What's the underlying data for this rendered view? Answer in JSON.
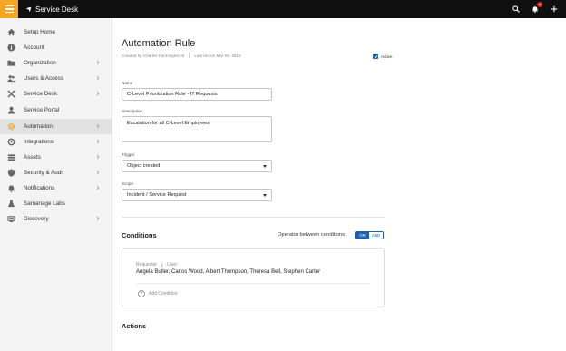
{
  "header": {
    "app_name": "Service Desk",
    "notification_count": "4"
  },
  "sidebar": {
    "items": [
      {
        "label": "Setup Home",
        "icon": "home-icon",
        "chevron": false,
        "active": false
      },
      {
        "label": "Account",
        "icon": "info-icon",
        "chevron": false,
        "active": false
      },
      {
        "label": "Organization",
        "icon": "folder-icon",
        "chevron": true,
        "active": false
      },
      {
        "label": "Users & Access",
        "icon": "users-icon",
        "chevron": true,
        "active": false
      },
      {
        "label": "Service Desk",
        "icon": "tools-icon",
        "chevron": true,
        "active": false
      },
      {
        "label": "Service Portal",
        "icon": "person-icon",
        "chevron": false,
        "active": false
      },
      {
        "label": "Automation",
        "icon": "gear-icon",
        "chevron": true,
        "active": true
      },
      {
        "label": "Integrations",
        "icon": "plug-icon",
        "chevron": true,
        "active": false
      },
      {
        "label": "Assets",
        "icon": "stack-icon",
        "chevron": true,
        "active": false
      },
      {
        "label": "Security & Audit",
        "icon": "shield-icon",
        "chevron": true,
        "active": false
      },
      {
        "label": "Notifications",
        "icon": "bell-icon",
        "chevron": true,
        "active": false
      },
      {
        "label": "Samanage Labs",
        "icon": "flask-icon",
        "chevron": false,
        "active": false
      },
      {
        "label": "Discovery",
        "icon": "network-icon",
        "chevron": true,
        "active": false
      }
    ]
  },
  "page": {
    "title": "Automation Rule",
    "created_by": "Created by Charles Farmington III",
    "last_run": "Last run on Mar 09, 2018",
    "active_label": "Active",
    "active_checked": true
  },
  "form": {
    "name_label": "Name",
    "name_value": "C-Level Prioritization Rule - IT Requests",
    "description_label": "Description",
    "description_value": "Escalation for all C-Level Employees",
    "trigger_label": "Trigger",
    "trigger_value": "Object created",
    "scope_label": "Scope",
    "scope_value": "Incident / Service Request"
  },
  "conditions": {
    "title": "Conditions",
    "operator_label": "Operator between conditions",
    "operator_options": [
      "OR",
      "AND"
    ],
    "operator_selected": "OR",
    "path_parent": "Requester",
    "path_child": "User:",
    "values": "Angela Butler, Carlos Wood, Albert Thompson, Theresa Bell, Stephen Carter",
    "add_label": "Add Condition"
  },
  "actions": {
    "title": "Actions"
  },
  "colors": {
    "topbar": "#0f0f0f",
    "menu_accent": "#f5a623",
    "automation_icon": "#f5a623",
    "primary_blue": "#1f5fa8",
    "badge_red": "#e02020"
  }
}
